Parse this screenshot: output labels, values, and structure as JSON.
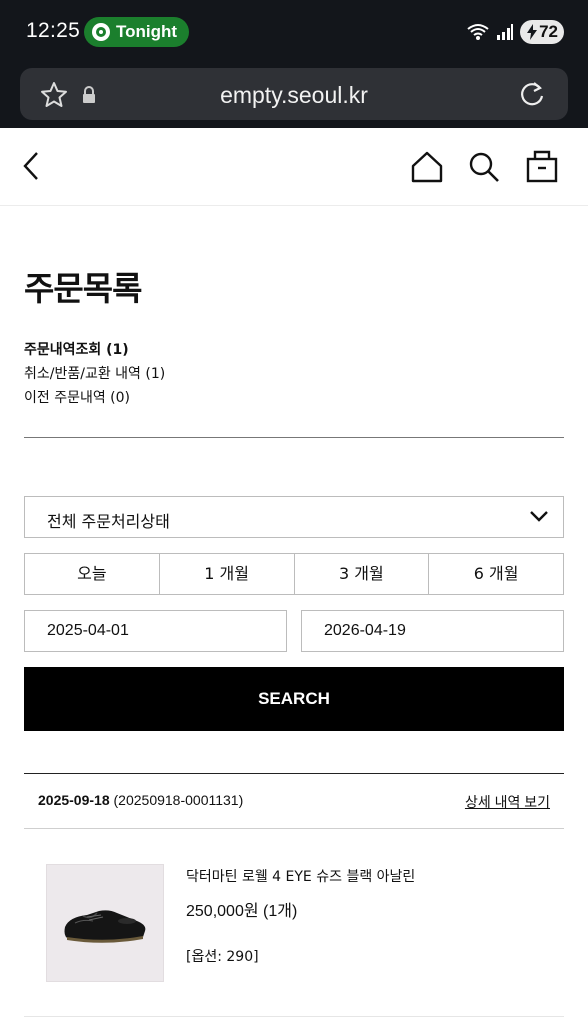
{
  "status": {
    "time": "12:25",
    "pill": "Tonight",
    "battery": "72"
  },
  "browser": {
    "url": "empty.seoul.kr"
  },
  "page": {
    "title": "주문목록",
    "menu": [
      "주문내역조회 (1)",
      "취소/반품/교환 내역 (1)",
      "이전 주문내역 (0)"
    ],
    "status_select": "전체 주문처리상태",
    "periods": [
      "오늘",
      "1 개월",
      "3 개월",
      "6 개월"
    ],
    "date_from": "2025-04-01",
    "date_to": "2026-04-19",
    "search_label": "SEARCH"
  },
  "order": {
    "date": "2025-09-18",
    "number": "(20250918-0001131)",
    "detail_link": "상세 내역 보기",
    "product_name": "닥터마틴 로웰 4 EYE 슈즈 블랙 아날린",
    "price": "250,000원 (1개)",
    "option": "[옵션: 290]"
  },
  "icons": [
    "back-arrow-icon",
    "home-icon",
    "search-icon",
    "bag-icon",
    "star-icon",
    "lock-icon",
    "reload-icon",
    "wifi-icon",
    "signal-icon",
    "battery-icon",
    "chevron-down-icon"
  ]
}
